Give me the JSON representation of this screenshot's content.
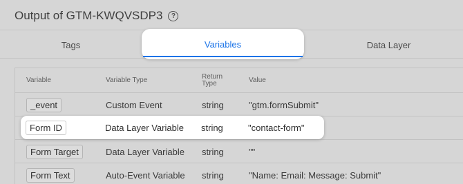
{
  "page": {
    "title": "Output of GTM-KWQVSDP3",
    "help_icon": "?"
  },
  "tabs": [
    {
      "label": "Tags",
      "active": false
    },
    {
      "label": "Variables",
      "active": true
    },
    {
      "label": "Data Layer",
      "active": false
    }
  ],
  "table": {
    "headers": {
      "variable": "Variable",
      "type": "Variable Type",
      "return_type": "Return Type",
      "value": "Value"
    },
    "rows": [
      {
        "variable": "_event",
        "type": "Custom Event",
        "return_type": "string",
        "value": "\"gtm.formSubmit\""
      },
      {
        "variable": "Form ID",
        "type": "Data Layer Variable",
        "return_type": "string",
        "value": "\"contact-form\""
      },
      {
        "variable": "Form Target",
        "type": "Data Layer Variable",
        "return_type": "string",
        "value": "\"\""
      },
      {
        "variable": "Form Text",
        "type": "Auto-Event Variable",
        "return_type": "string",
        "value": "\"Name: Email: Message: Submit\""
      }
    ]
  },
  "colors": {
    "accent": "#1a73e8",
    "background": "#d6d6d6"
  }
}
